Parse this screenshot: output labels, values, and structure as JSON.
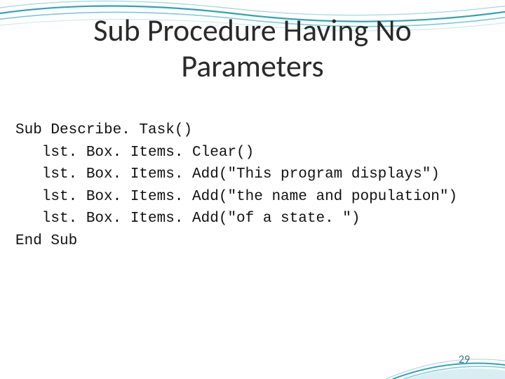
{
  "title_line1": "Sub Procedure Having No",
  "title_line2": "Parameters",
  "code": {
    "l1": "Sub Describe. Task()",
    "l2": "   lst. Box. Items. Clear()",
    "l3": "   lst. Box. Items. Add(\"This program displays\")",
    "l4": "   lst. Box. Items. Add(\"the name and population\")",
    "l5": "   lst. Box. Items. Add(\"of a state. \")",
    "l6": "End Sub"
  },
  "page_number": "29"
}
